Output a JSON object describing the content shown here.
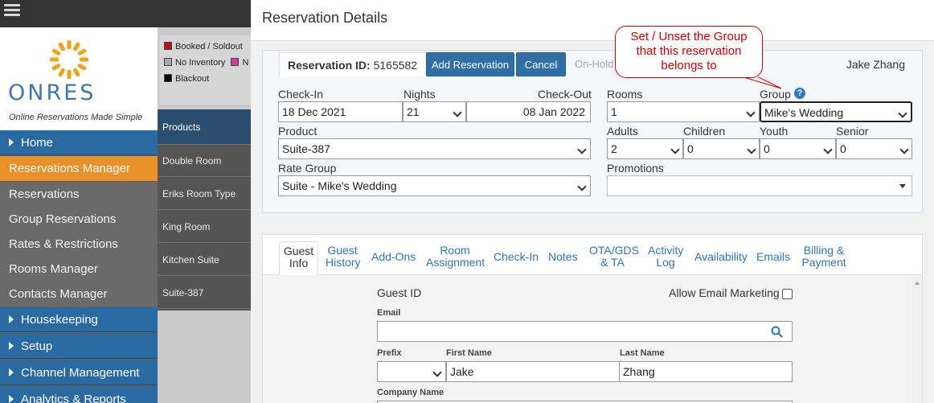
{
  "sidebar": {
    "tagline": "Online Reservations Made Simple",
    "logo_text": "ONRES",
    "sections": {
      "home": "Home",
      "housekeeping": "Housekeeping",
      "setup": "Setup",
      "channel": "Channel Management",
      "analytics": "Analytics & Reports"
    },
    "active_item": "Reservations Manager",
    "items": [
      "Reservations",
      "Group Reservations",
      "Rates & Restrictions",
      "Rooms Manager",
      "Contacts Manager"
    ]
  },
  "legend": {
    "booked": "Booked / Soldout",
    "no_inventory": "No Inventory",
    "n_cut": "N",
    "blackout": "Blackout",
    "colors": {
      "booked": "#b5121b",
      "no_inventory": "#a8a8a8",
      "pink": "#d63a9c",
      "blackout": "#000000"
    }
  },
  "products": {
    "header": "Products",
    "rows": [
      "Double Room",
      "Eriks Room Type",
      "King Room",
      "Kitchen Suite",
      "Suite-387"
    ]
  },
  "panel": {
    "title": "Reservation Details",
    "reservation_id_label": "Reservation ID:",
    "reservation_id_value": "5165582",
    "add_reservation": "Add Reservation",
    "cancel": "Cancel",
    "on_hold": "On-Hold",
    "guest_name": "Jake Zhang",
    "checkin_label": "Check-In",
    "checkin_value": "18 Dec 2021",
    "nights_label": "Nights",
    "nights_value": "21",
    "checkout_label": "Check-Out",
    "checkout_value": "08 Jan 2022",
    "rooms_label": "Rooms",
    "rooms_value": "1",
    "group_label": "Group",
    "group_value": "Mike's Wedding",
    "product_label": "Product",
    "product_value": "Suite-387",
    "adults_label": "Adults",
    "adults_value": "2",
    "children_label": "Children",
    "children_value": "0",
    "youth_label": "Youth",
    "youth_value": "0",
    "senior_label": "Senior",
    "senior_value": "0",
    "rate_group_label": "Rate Group",
    "rate_group_value": "Suite - Mike's Wedding",
    "promotions_label": "Promotions",
    "promotions_value": ""
  },
  "tabs": [
    {
      "line1": "Guest",
      "line2": "Info"
    },
    {
      "line1": "Guest",
      "line2": "History"
    },
    {
      "line1": "Add-Ons",
      "line2": ""
    },
    {
      "line1": "Room",
      "line2": "Assignment"
    },
    {
      "line1": "Check-In",
      "line2": ""
    },
    {
      "line1": "Notes",
      "line2": ""
    },
    {
      "line1": "OTA/GDS",
      "line2": "& TA"
    },
    {
      "line1": "Activity",
      "line2": "Log"
    },
    {
      "line1": "Availability",
      "line2": ""
    },
    {
      "line1": "Emails",
      "line2": ""
    },
    {
      "line1": "Billing &",
      "line2": "Payment"
    }
  ],
  "guest": {
    "guest_id_label": "Guest ID",
    "allow_email_label": "Allow Email Marketing",
    "email_label": "Email",
    "email_value": "",
    "prefix_label": "Prefix",
    "prefix_value": "",
    "first_name_label": "First Name",
    "first_name_value": "Jake",
    "last_name_label": "Last Name",
    "last_name_value": "Zhang",
    "company_label": "Company Name"
  },
  "callout": {
    "line1": "Set / Unset the Group",
    "line2": "that this reservation",
    "line3": "belongs to"
  }
}
